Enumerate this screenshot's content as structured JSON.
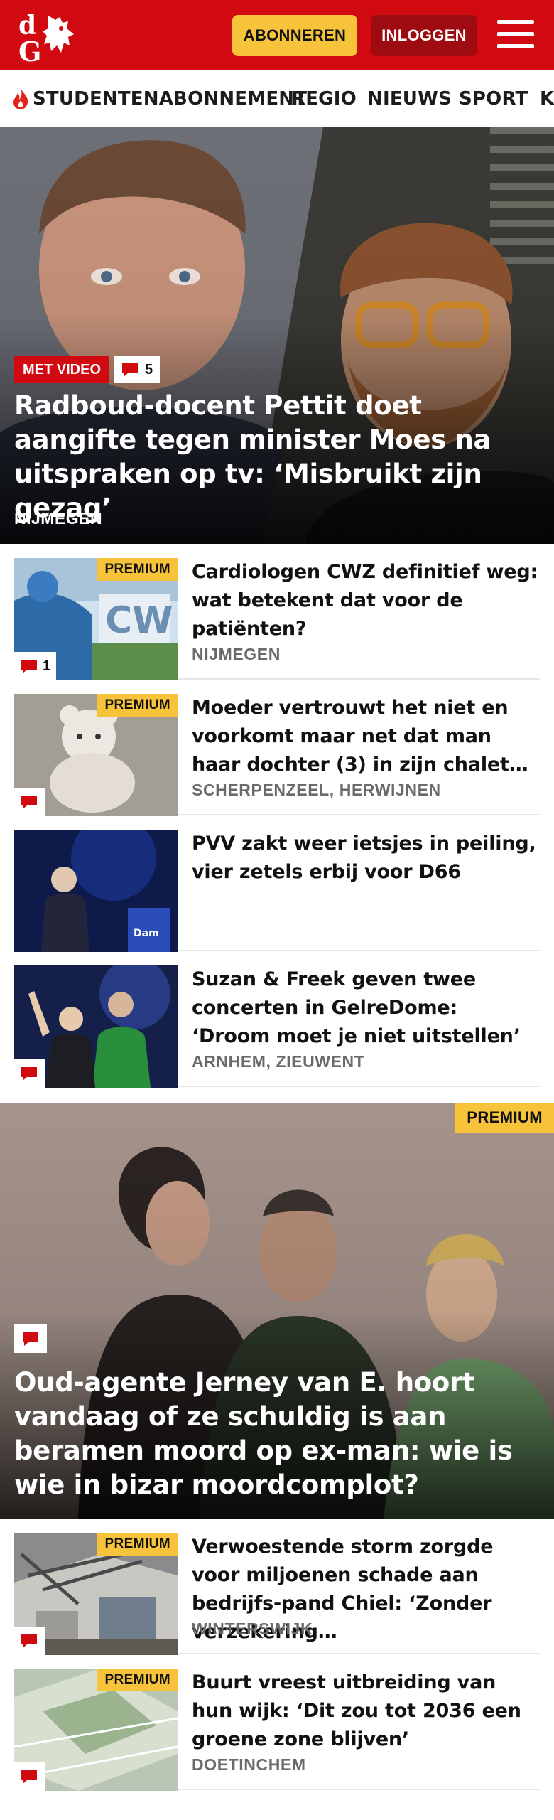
{
  "header": {
    "logo_text": "dG",
    "subscribe_label": "ABONNEREN",
    "login_label": "INLOGGEN",
    "brand_color": "#d10a11",
    "accent_color": "#f6c33a"
  },
  "nav": {
    "items": [
      {
        "label": "STUDENTENABONNEMENT",
        "icon": "flame-icon"
      },
      {
        "label": "REGIO"
      },
      {
        "label": "NIEUWS"
      },
      {
        "label": "SPORT"
      },
      {
        "label": "K"
      }
    ]
  },
  "hero": {
    "badge": "MET VIDEO",
    "comments": "5",
    "title": "Radboud-docent Pettit doet aangifte tegen minister Moes na uitspraken op tv: ‘Misbruikt zijn gezag’",
    "tag": "NIJMEGEN"
  },
  "articles": [
    {
      "premium": "PREMIUM",
      "comments": "1",
      "title": "Cardiologen CWZ definitief weg: wat betekent dat voor de patiënten?",
      "tag": "NIJMEGEN"
    },
    {
      "premium": "PREMIUM",
      "comments": "",
      "title": "Moeder vertrouwt het niet en voorkomt maar net dat man haar dochter (3) in zijn chalet…",
      "tag": "SCHERPENZEEL, HERWIJNEN"
    },
    {
      "title": "PVV zakt weer ietsjes in peiling, vier zetels erbij voor D66",
      "tag": ""
    },
    {
      "comments": "",
      "title": "Suzan & Freek geven twee concerten in GelreDome: ‘Droom moet je niet uitstellen’",
      "tag": "ARNHEM, ZIEUWENT"
    }
  ],
  "feature": {
    "premium": "PREMIUM",
    "title": "Oud-agente Jerney van E. hoort vandaag of ze schuldig is aan beramen moord op ex-man: wie is wie in bizar moordcomplot?"
  },
  "articles2": [
    {
      "premium": "PREMIUM",
      "title": "Verwoestende storm zorgde voor miljoenen schade aan bedrijfs-pand Chiel: ‘Zonder verzekering…",
      "tag": "WINTERSWIJK"
    },
    {
      "premium": "PREMIUM",
      "title": "Buurt vreest uitbreiding van hun wijk: ‘Dit zou tot 2036 een groene zone blijven’",
      "tag": "DOETINCHEM"
    }
  ]
}
